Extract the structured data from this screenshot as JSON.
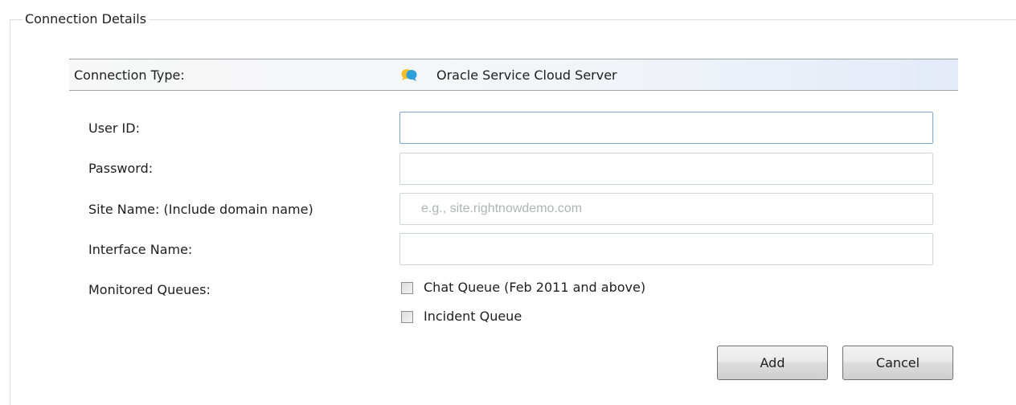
{
  "group": {
    "title": "Connection Details"
  },
  "connection_type": {
    "label": "Connection Type:",
    "value": "Oracle Service Cloud Server",
    "icon": "chat-bubbles-icon",
    "icon_colors": [
      "#f2c02a",
      "#2e9fd8"
    ]
  },
  "fields": {
    "user_id": {
      "label": "User ID:",
      "value": "",
      "placeholder": ""
    },
    "password": {
      "label": "Password:",
      "value": "",
      "placeholder": ""
    },
    "site_name": {
      "label": "Site Name: (Include domain name)",
      "value": "",
      "placeholder": "e.g., site.rightnowdemo.com"
    },
    "interface_name": {
      "label": "Interface Name:",
      "value": "",
      "placeholder": ""
    }
  },
  "monitored_queues": {
    "label": "Monitored Queues:",
    "options": [
      {
        "label": "Chat Queue (Feb 2011 and above)",
        "checked": false
      },
      {
        "label": "Incident Queue",
        "checked": false
      }
    ]
  },
  "buttons": {
    "add": "Add",
    "cancel": "Cancel"
  }
}
